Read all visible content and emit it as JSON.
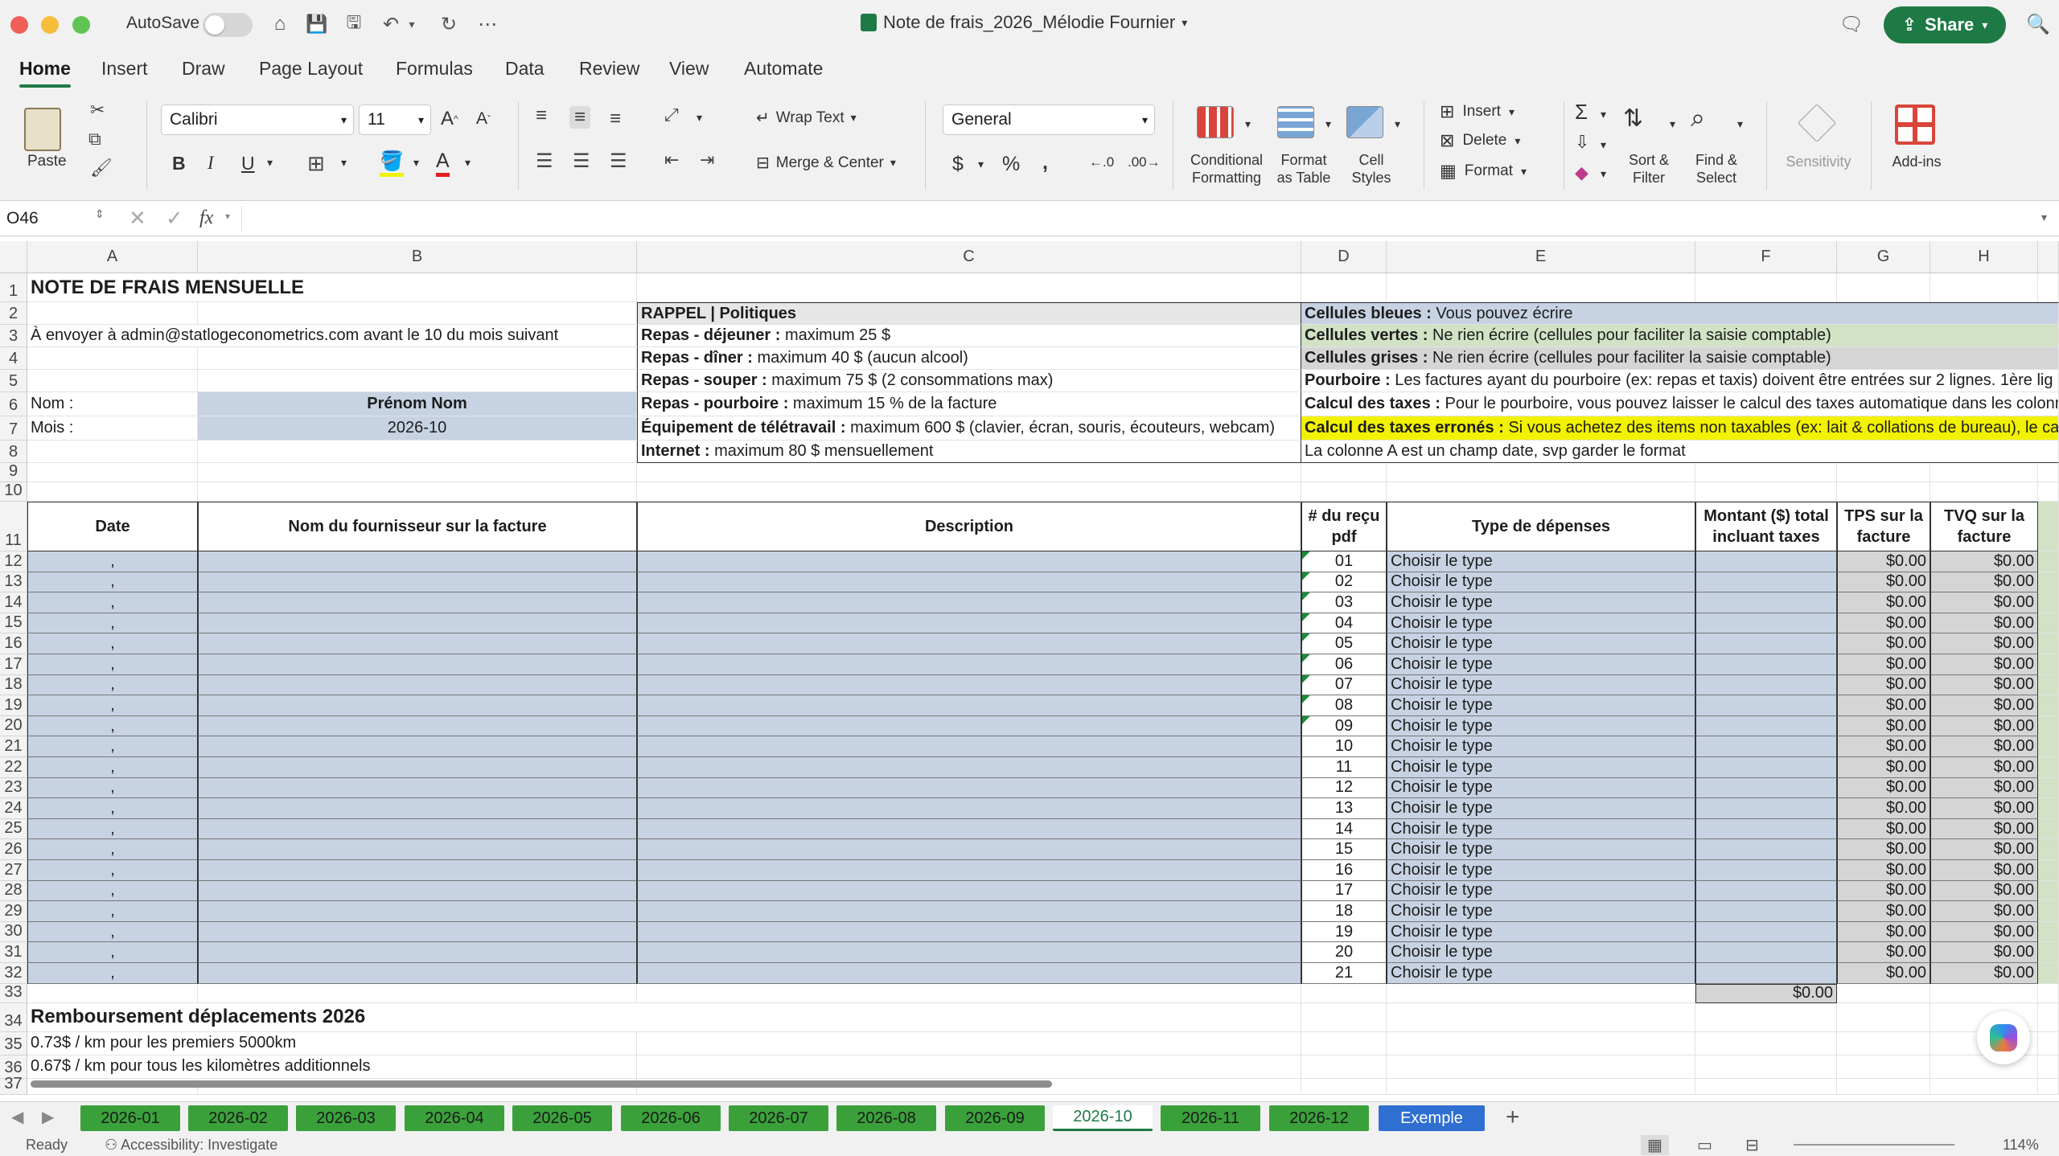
{
  "window": {
    "autosave_label": "AutoSave",
    "title": "Note de frais_2026_Mélodie Fournier",
    "share_label": "Share"
  },
  "tabs": [
    "Home",
    "Insert",
    "Draw",
    "Page Layout",
    "Formulas",
    "Data",
    "Review",
    "View",
    "Automate"
  ],
  "ribbon": {
    "paste": "Paste",
    "font_name": "Calibri",
    "font_size": "11",
    "wrap_text": "Wrap Text",
    "merge_center": "Merge & Center",
    "number_format": "General",
    "conditional_formatting": [
      "Conditional",
      "Formatting"
    ],
    "format_as_table": [
      "Format",
      "as Table"
    ],
    "cell_styles": [
      "Cell",
      "Styles"
    ],
    "insert": "Insert",
    "delete": "Delete",
    "format": "Format",
    "sort_filter": [
      "Sort &",
      "Filter"
    ],
    "find_select": [
      "Find &",
      "Select"
    ],
    "sensitivity": "Sensitivity",
    "add_ins": "Add-ins",
    "bold": "B",
    "italic": "I",
    "underline": "U"
  },
  "formula_bar": {
    "name_box": "O46",
    "fx": "fx"
  },
  "columns": [
    "A",
    "B",
    "C",
    "D",
    "E",
    "F",
    "G",
    "H"
  ],
  "sheet": {
    "a1": "NOTE DE FRAIS MENSUELLE",
    "a3": "À envoyer à admin@statlogeconometrics.com avant le 10 du mois suivant",
    "a6": "Nom :",
    "b6": "Prénom Nom",
    "a7": "Mois :",
    "b7": "2026-10",
    "policies": [
      {
        "bold": "RAPPEL | Politiques",
        "text": ""
      },
      {
        "bold": "Repas - déjeuner :",
        "text": " maximum 25 $"
      },
      {
        "bold": "Repas - dîner :",
        "text": " maximum 40 $ (aucun alcool)"
      },
      {
        "bold": "Repas - souper :",
        "text": " maximum 75 $ (2 consommations max)"
      },
      {
        "bold": "Repas - pourboire :",
        "text": " maximum 15 % de la facture"
      },
      {
        "bold": "Équipement de télétravail :",
        "text": " maximum 600 $ (clavier, écran, souris, écouteurs, webcam)"
      },
      {
        "bold": "Internet :",
        "text": " maximum 80 $ mensuellement"
      }
    ],
    "legend": [
      {
        "bold": "Cellules bleues :",
        "text": " Vous pouvez écrire"
      },
      {
        "bold": "Cellules vertes :",
        "text": " Ne rien écrire (cellules pour faciliter la saisie comptable)"
      },
      {
        "bold": "Cellules grises :",
        "text": " Ne rien écrire (cellules pour faciliter la saisie comptable)"
      },
      {
        "bold": "Pourboire :",
        "text": " Les factures ayant du pourboire (ex: repas et taxis) doivent être entrées sur 2 lignes. 1ère lig"
      },
      {
        "bold": "Calcul des taxes :",
        "text": " Pour le pourboire, vous pouvez laisser le calcul des taxes automatique dans les colonne"
      },
      {
        "bold": "Calcul des taxes erronés :",
        "text": " Si vous achetez des items non taxables (ex: lait & collations de bureau), le calcu"
      },
      {
        "bold": "",
        "text": "La colonne A est un champ date, svp garder le format"
      }
    ],
    "headers": {
      "date": "Date",
      "supplier": "Nom du fournisseur sur la facture",
      "description": "Description",
      "receipt": "# du reçu pdf",
      "type": "Type de dépenses",
      "amount": "Montant ($) total incluant taxes",
      "tps": "TPS sur la facture",
      "tvq": "TVQ sur la facture"
    },
    "row_date_placeholder": ",",
    "receipts": [
      "01",
      "02",
      "03",
      "04",
      "05",
      "06",
      "07",
      "08",
      "09",
      "10",
      "11",
      "12",
      "13",
      "14",
      "15",
      "16",
      "17",
      "18",
      "19",
      "20",
      "21"
    ],
    "type_placeholder": "Choisir le type",
    "zero_value": "$0.00",
    "total_amount": "$0.00",
    "travel_title": "Remboursement déplacements 2026",
    "travel_rate1": "0.73$ / km pour les premiers 5000km",
    "travel_rate2": "0.67$ / km pour tous les kilomètres additionnels"
  },
  "sheet_tabs": [
    "2026-01",
    "2026-02",
    "2026-03",
    "2026-04",
    "2026-05",
    "2026-06",
    "2026-07",
    "2026-08",
    "2026-09",
    "2026-10",
    "2026-11",
    "2026-12",
    "Exemple"
  ],
  "active_sheet": "2026-10",
  "status": {
    "ready": "Ready",
    "accessibility": "Accessibility: Investigate",
    "zoom": "114%"
  }
}
